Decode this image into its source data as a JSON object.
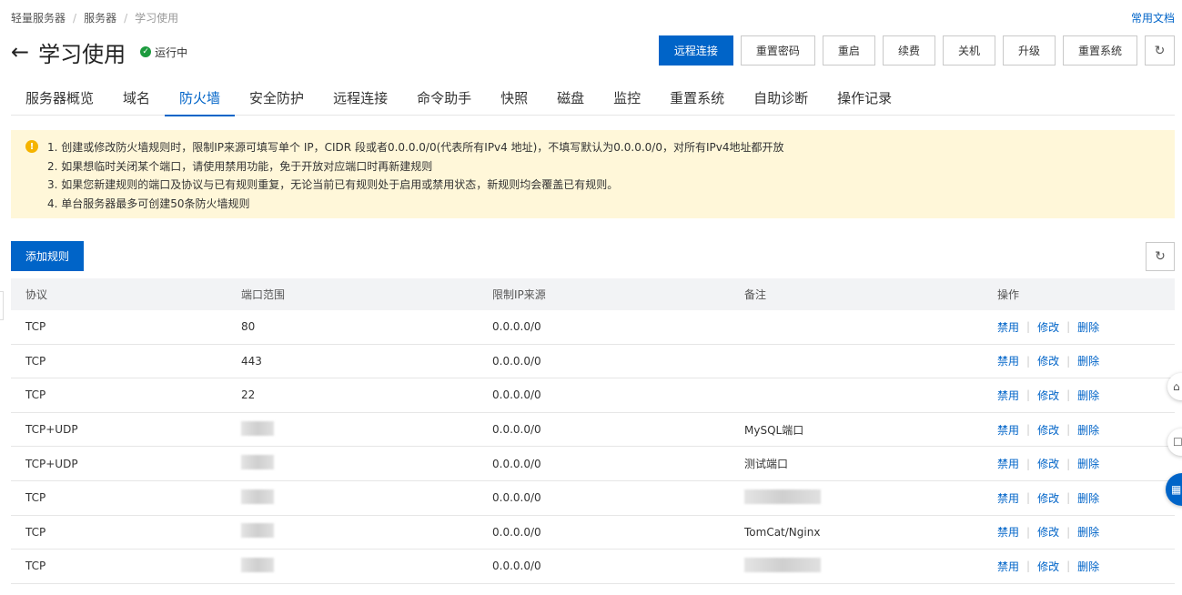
{
  "breadcrumb": {
    "item1": "轻量服务器",
    "item2": "服务器",
    "current": "学习使用"
  },
  "docs_link": "常用文档",
  "header": {
    "title": "学习使用",
    "status": "运行中"
  },
  "actions": [
    "远程连接",
    "重置密码",
    "重启",
    "续费",
    "关机",
    "升级",
    "重置系统"
  ],
  "tabs": [
    "服务器概览",
    "域名",
    "防火墙",
    "安全防护",
    "远程连接",
    "命令助手",
    "快照",
    "磁盘",
    "监控",
    "重置系统",
    "自助诊断",
    "操作记录"
  ],
  "active_tab": "防火墙",
  "notice": {
    "lines": [
      "1. 创建或修改防火墙规则时，限制IP来源可填写单个 IP，CIDR 段或者0.0.0.0/0(代表所有IPv4 地址)，不填写默认为0.0.0.0/0，对所有IPv4地址都开放",
      "2. 如果想临时关闭某个端口，请使用禁用功能，免于开放对应端口时再新建规则",
      "3. 如果您新建规则的端口及协议与已有规则重复，无论当前已有规则处于启用或禁用状态，新规则均会覆盖已有规则。",
      "4. 单台服务器最多可创建50条防火墙规则"
    ]
  },
  "add_button": "添加规则",
  "table": {
    "headers": [
      "协议",
      "端口范围",
      "限制IP来源",
      "备注",
      "操作"
    ],
    "ops": {
      "disable": "禁用",
      "edit": "修改",
      "delete": "删除"
    },
    "rows": [
      {
        "protocol": "TCP",
        "port": "80",
        "source": "0.0.0.0/0",
        "note": ""
      },
      {
        "protocol": "TCP",
        "port": "443",
        "source": "0.0.0.0/0",
        "note": ""
      },
      {
        "protocol": "TCP",
        "port": "22",
        "source": "0.0.0.0/0",
        "note": ""
      },
      {
        "protocol": "TCP+UDP",
        "port": "",
        "source": "0.0.0.0/0",
        "note": "MySQL端口"
      },
      {
        "protocol": "TCP+UDP",
        "port": "",
        "source": "0.0.0.0/0",
        "note": "测试端口"
      },
      {
        "protocol": "TCP",
        "port": "",
        "source": "0.0.0.0/0",
        "note": ""
      },
      {
        "protocol": "TCP",
        "port": "",
        "source": "0.0.0.0/0",
        "note": "TomCat/Nginx"
      },
      {
        "protocol": "TCP",
        "port": "",
        "source": "0.0.0.0/0",
        "note": ""
      }
    ]
  },
  "colors": {
    "primary": "#0064c8",
    "notice_bg": "#fff7d9",
    "status_green": "#1c9b3e",
    "warning": "#f5b400"
  },
  "icons": {
    "back": "arrow-left-icon",
    "status": "check-circle-icon",
    "refresh": "refresh-icon",
    "notice": "warning-icon"
  }
}
